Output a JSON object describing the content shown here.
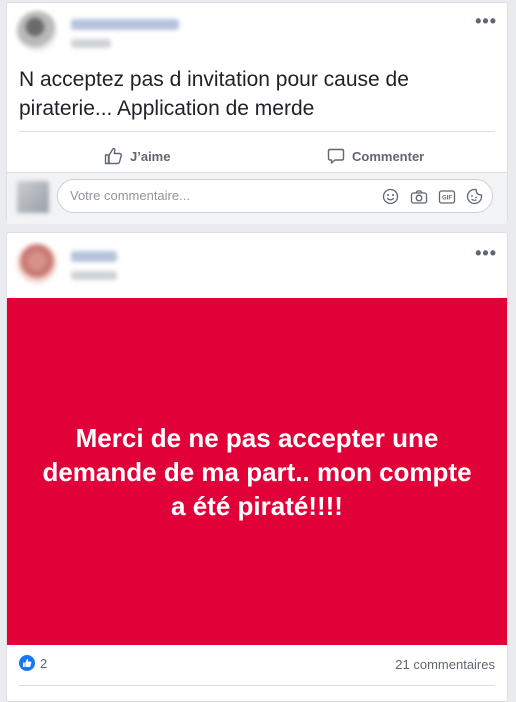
{
  "posts": [
    {
      "text": "N acceptez pas d invitation pour cause de piraterie... Application de merde",
      "actions": {
        "like_label": "J’aime",
        "comment_label": "Commenter"
      },
      "comment_box": {
        "placeholder": "Votre commentaire..."
      },
      "icons": [
        "emoji-icon",
        "camera-icon",
        "gif-icon",
        "sticker-icon"
      ]
    },
    {
      "banner_text": "Merci de ne pas accepter une demande de ma part.. mon compte a été piraté!!!!",
      "banner_color": "#e20039",
      "reaction_count": "2",
      "comments_count": "21 commentaires"
    }
  ]
}
